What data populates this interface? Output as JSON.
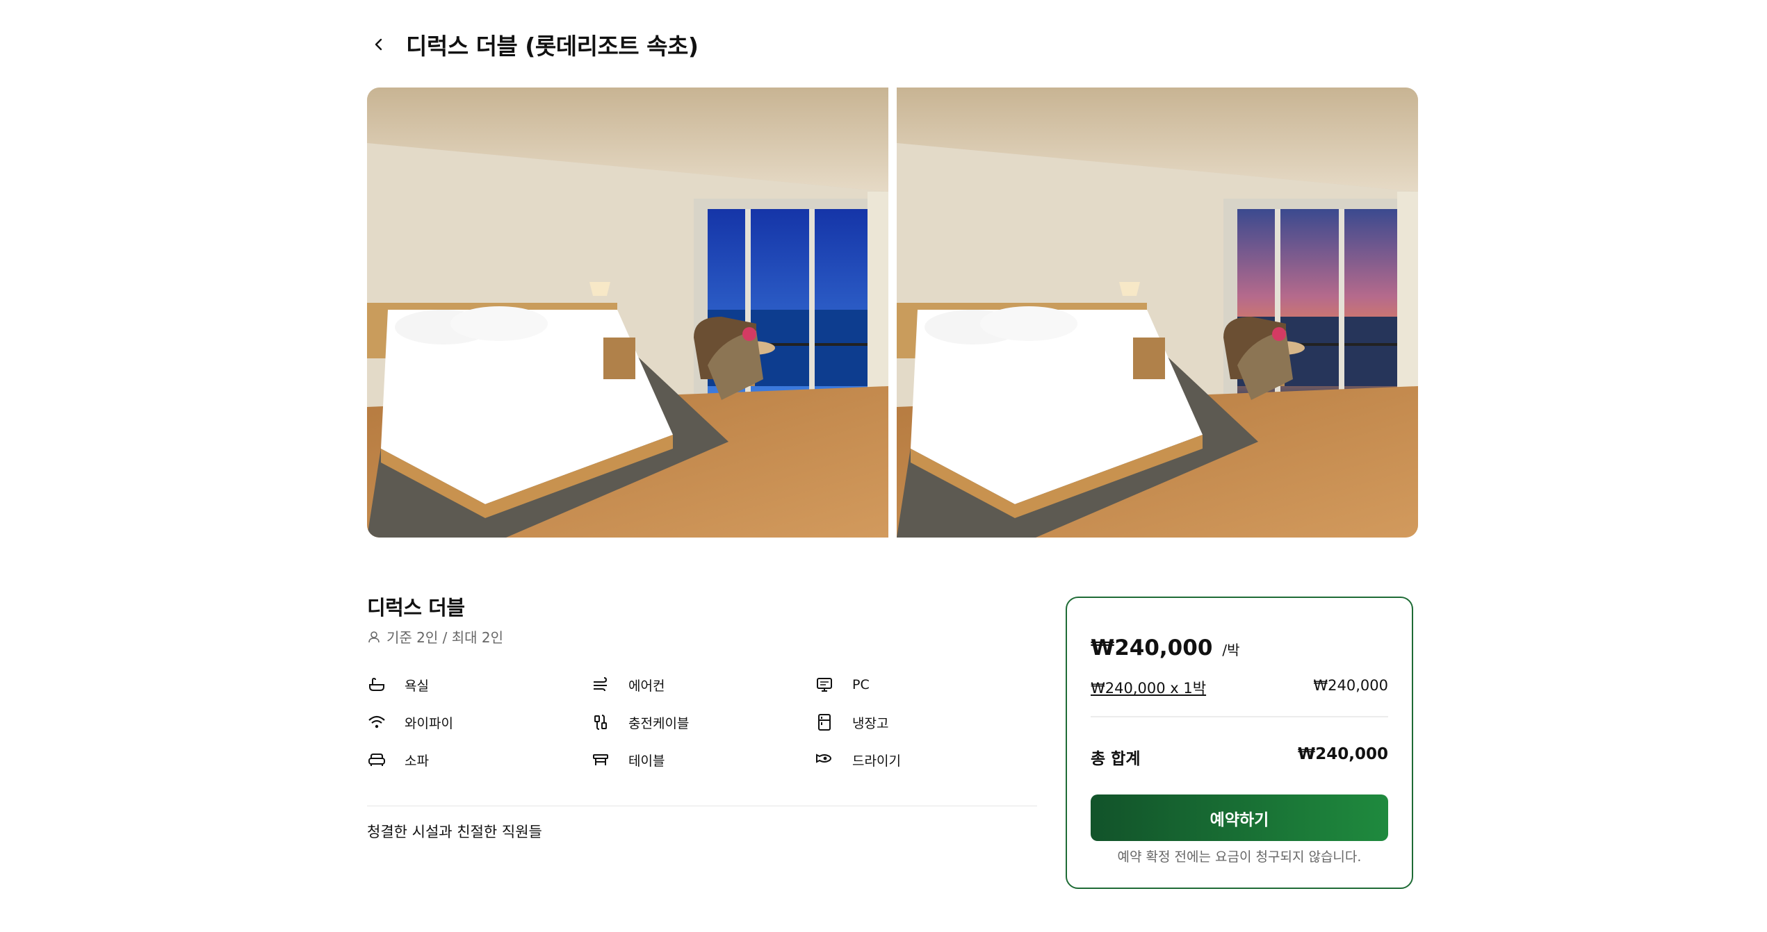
{
  "header": {
    "title": "디럭스 더블 (롯데리조트 속초)",
    "back_icon": "chevron-left-icon"
  },
  "gallery": {
    "photos": [
      "bedroom-ocean-view-day",
      "bedroom-ocean-view-sunset"
    ]
  },
  "room": {
    "name": "디럭스 더블",
    "occupancy": "기준 2인 / 최대 2인",
    "occupancy_icon": "person-icon"
  },
  "amenities": [
    {
      "label": "욕실",
      "icon": "bathtub-icon"
    },
    {
      "label": "에어컨",
      "icon": "wind-icon"
    },
    {
      "label": "PC",
      "icon": "monitor-icon"
    },
    {
      "label": "와이파이",
      "icon": "wifi-icon"
    },
    {
      "label": "충전케이블",
      "icon": "cable-icon"
    },
    {
      "label": "냉장고",
      "icon": "refrigerator-icon"
    },
    {
      "label": "소파",
      "icon": "sofa-icon"
    },
    {
      "label": "테이블",
      "icon": "table-icon"
    },
    {
      "label": "드라이기",
      "icon": "hair-dryer-icon"
    }
  ],
  "description": "청결한 시설과 친절한 직원들",
  "booking": {
    "price": "₩240,000",
    "per_night": "/박",
    "calc_label": "₩240,000 x 1박",
    "calc_value": "₩240,000",
    "total_label": "총 합계",
    "total_value": "₩240,000",
    "reserve_label": "예약하기",
    "notice": "예약 확정 전에는 요금이 청구되지 않습니다.",
    "accent_color": "#1e6b35"
  }
}
